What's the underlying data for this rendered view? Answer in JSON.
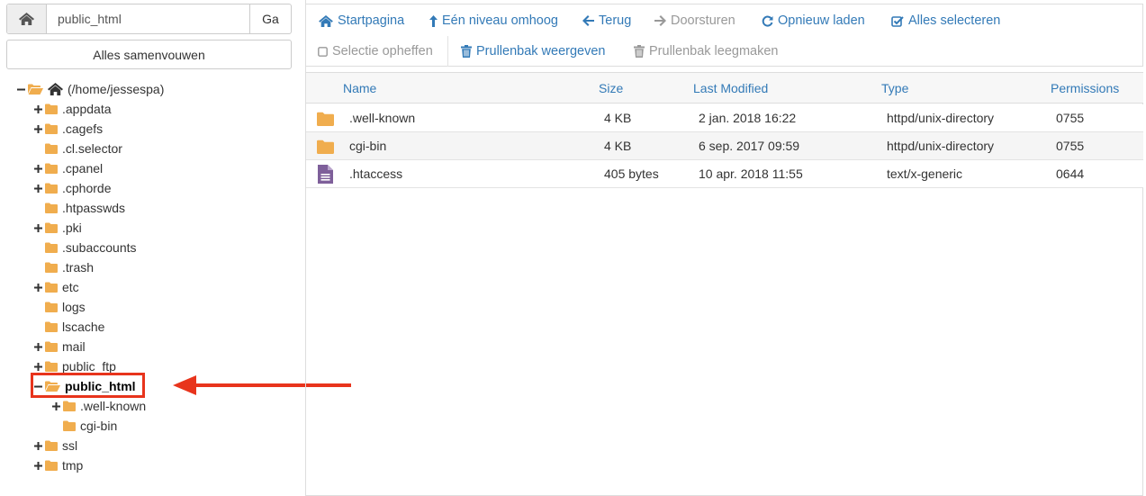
{
  "left": {
    "path_value": "public_html",
    "go_label": "Ga",
    "collapse_label": "Alles samenvouwen",
    "tree": [
      {
        "label": "(/home/jessespa)",
        "state": "open",
        "root": true
      },
      {
        "label": ".appdata",
        "state": "closed"
      },
      {
        "label": ".cagefs",
        "state": "closed"
      },
      {
        "label": ".cl.selector",
        "state": "leaf"
      },
      {
        "label": ".cpanel",
        "state": "closed"
      },
      {
        "label": ".cphorde",
        "state": "closed"
      },
      {
        "label": ".htpasswds",
        "state": "leaf"
      },
      {
        "label": ".pki",
        "state": "closed"
      },
      {
        "label": ".subaccounts",
        "state": "leaf"
      },
      {
        "label": ".trash",
        "state": "leaf"
      },
      {
        "label": "etc",
        "state": "closed"
      },
      {
        "label": "logs",
        "state": "leaf"
      },
      {
        "label": "lscache",
        "state": "leaf"
      },
      {
        "label": "mail",
        "state": "closed"
      },
      {
        "label": "public_ftp",
        "state": "closed"
      },
      {
        "label": "public_html",
        "state": "open",
        "selected": true
      },
      {
        "label": ".well-known",
        "state": "closed",
        "child": true
      },
      {
        "label": "cgi-bin",
        "state": "leaf",
        "child": true
      },
      {
        "label": "ssl",
        "state": "closed"
      },
      {
        "label": "tmp",
        "state": "closed"
      }
    ]
  },
  "toolbar": {
    "home": "Startpagina",
    "up": "Eén niveau omhoog",
    "back": "Terug",
    "forward": "Doorsturen",
    "reload": "Opnieuw laden",
    "select_all": "Alles selecteren",
    "deselect": "Selectie opheffen",
    "view_trash": "Prullenbak weergeven",
    "empty_trash": "Prullenbak leegmaken"
  },
  "table": {
    "headers": {
      "name": "Name",
      "size": "Size",
      "modified": "Last Modified",
      "type": "Type",
      "perms": "Permissions"
    },
    "rows": [
      {
        "icon": "folder-icon",
        "name": ".well-known",
        "size": "4 KB",
        "modified": "2 jan. 2018 16:22",
        "type": "httpd/unix-directory",
        "perms": "0755"
      },
      {
        "icon": "folder-icon",
        "name": "cgi-bin",
        "size": "4 KB",
        "modified": "6 sep. 2017 09:59",
        "type": "httpd/unix-directory",
        "perms": "0755"
      },
      {
        "icon": "file-text-icon",
        "name": ".htaccess",
        "size": "405 bytes",
        "modified": "10 apr. 2018 11:55",
        "type": "text/x-generic",
        "perms": "0644"
      }
    ]
  },
  "colors": {
    "link": "#337ab7",
    "folder": "#f0ad4e",
    "file": "#7e5f9a",
    "highlight": "#e8341c"
  }
}
